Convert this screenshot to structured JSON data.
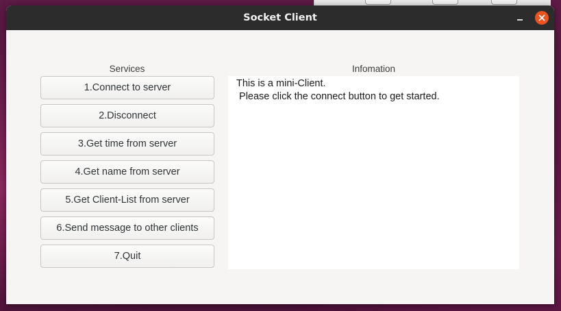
{
  "window": {
    "title": "Socket Client"
  },
  "services": {
    "label": "Services",
    "buttons": [
      "1.Connect to server",
      "2.Disconnect",
      "3.Get time from server",
      "4.Get name from server",
      "5.Get Client-List from server",
      "6.Send message to other clients",
      "7.Quit"
    ]
  },
  "information": {
    "label": "Infomation",
    "lines": [
      "This is a mini-Client.",
      " Please click the connect button to get started."
    ]
  },
  "colors": {
    "titlebar": "#2c2c2c",
    "close_button": "#e95420",
    "window_bg": "#f6f5f4"
  }
}
